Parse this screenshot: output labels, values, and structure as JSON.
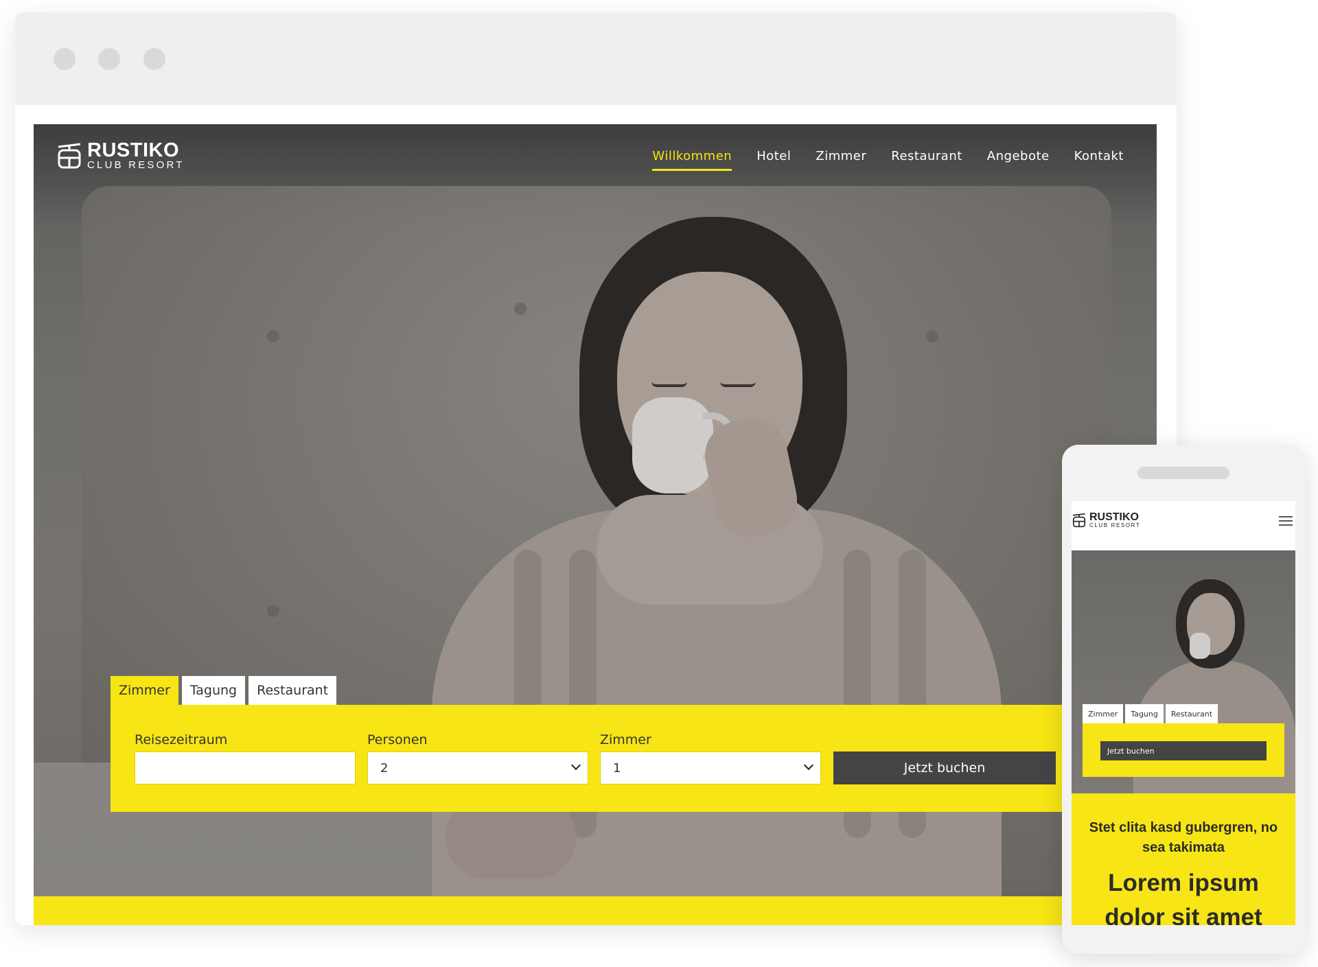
{
  "brand": {
    "name": "RUSTIKO",
    "tagline": "CLUB RESORT",
    "accent_color": "#f7e515"
  },
  "nav": {
    "items": [
      {
        "label": "Willkommen",
        "active": true
      },
      {
        "label": "Hotel",
        "active": false
      },
      {
        "label": "Zimmer",
        "active": false
      },
      {
        "label": "Restaurant",
        "active": false
      },
      {
        "label": "Angebote",
        "active": false
      },
      {
        "label": "Kontakt",
        "active": false
      }
    ]
  },
  "booking": {
    "tabs": [
      {
        "label": "Zimmer",
        "active": true
      },
      {
        "label": "Tagung",
        "active": false
      },
      {
        "label": "Restaurant",
        "active": false
      }
    ],
    "fields": {
      "travel_period": {
        "label": "Reisezeitraum",
        "value": ""
      },
      "persons": {
        "label": "Personen",
        "value": "2"
      },
      "rooms": {
        "label": "Zimmer",
        "value": "1"
      }
    },
    "submit_label": "Jetzt buchen"
  },
  "mobile": {
    "brand": {
      "name": "RUSTIKO",
      "tagline": "CLUB RESORT"
    },
    "tabs": [
      "Zimmer",
      "Tagung",
      "Restaurant"
    ],
    "submit_label": "Jetzt buchen",
    "subtitle": "Stet clita kasd gubergren, no sea takimata",
    "title": "Lorem ipsum dolor sit amet"
  },
  "icons": {
    "logo": "cable-car-icon",
    "menu": "hamburger-menu-icon",
    "select": "chevron-down-icon"
  }
}
